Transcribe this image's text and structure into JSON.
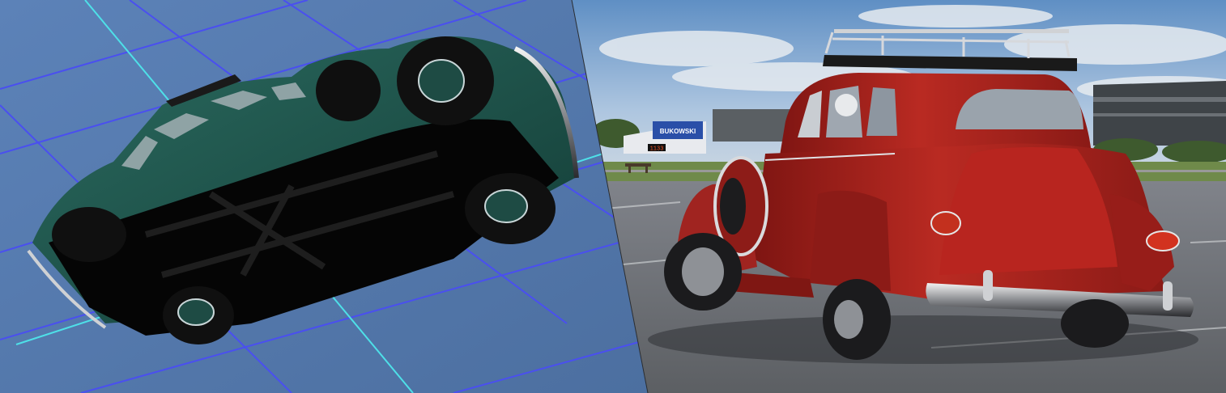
{
  "image": {
    "kind": "split-comparison",
    "left_view": "3d-editor-viewport-underside-of-green-vintage-car",
    "right_view": "in-game-render-red-vintage-car-rear-three-quarter"
  },
  "billboard": {
    "brand_text": "BUKOWSKI",
    "clock_text": "1133"
  },
  "colors": {
    "viewport_bg": "#5478a8",
    "grid_cyan": "#4ee0e8",
    "grid_blue": "#4a4ff0",
    "green_car": "#1d4c45",
    "red_car": "#a8201c",
    "sky": "#8fb0d4",
    "asphalt": "#6f7276"
  }
}
